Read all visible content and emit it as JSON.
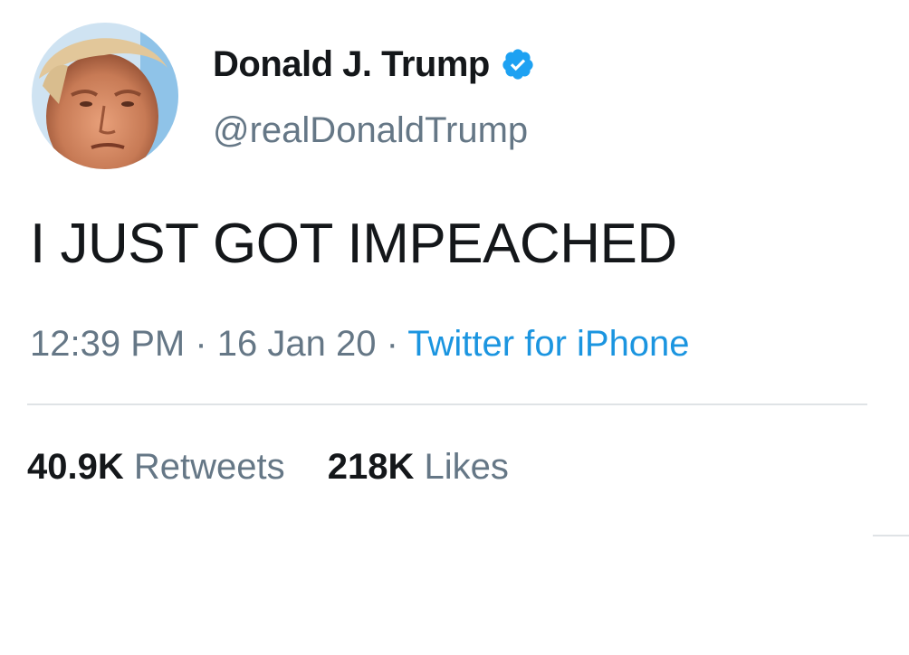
{
  "author": {
    "display_name": "Donald J. Trump",
    "handle": "@realDonaldTrump",
    "avatar_icon": "avatar-photo",
    "verified_icon": "verified-badge-icon",
    "verified_color": "#1da1f2"
  },
  "tweet": {
    "text": "I JUST GOT IMPEACHED",
    "time": "12:39 PM",
    "date": "16 Jan 20",
    "separator": " · ",
    "source": "Twitter for iPhone"
  },
  "stats": {
    "retweets_count": "40.9K",
    "retweets_label": "Retweets",
    "likes_count": "218K",
    "likes_label": "Likes"
  },
  "colors": {
    "text_primary": "#14171a",
    "text_secondary": "#657786",
    "link": "#1b95e0",
    "divider": "#dfe3e6"
  }
}
